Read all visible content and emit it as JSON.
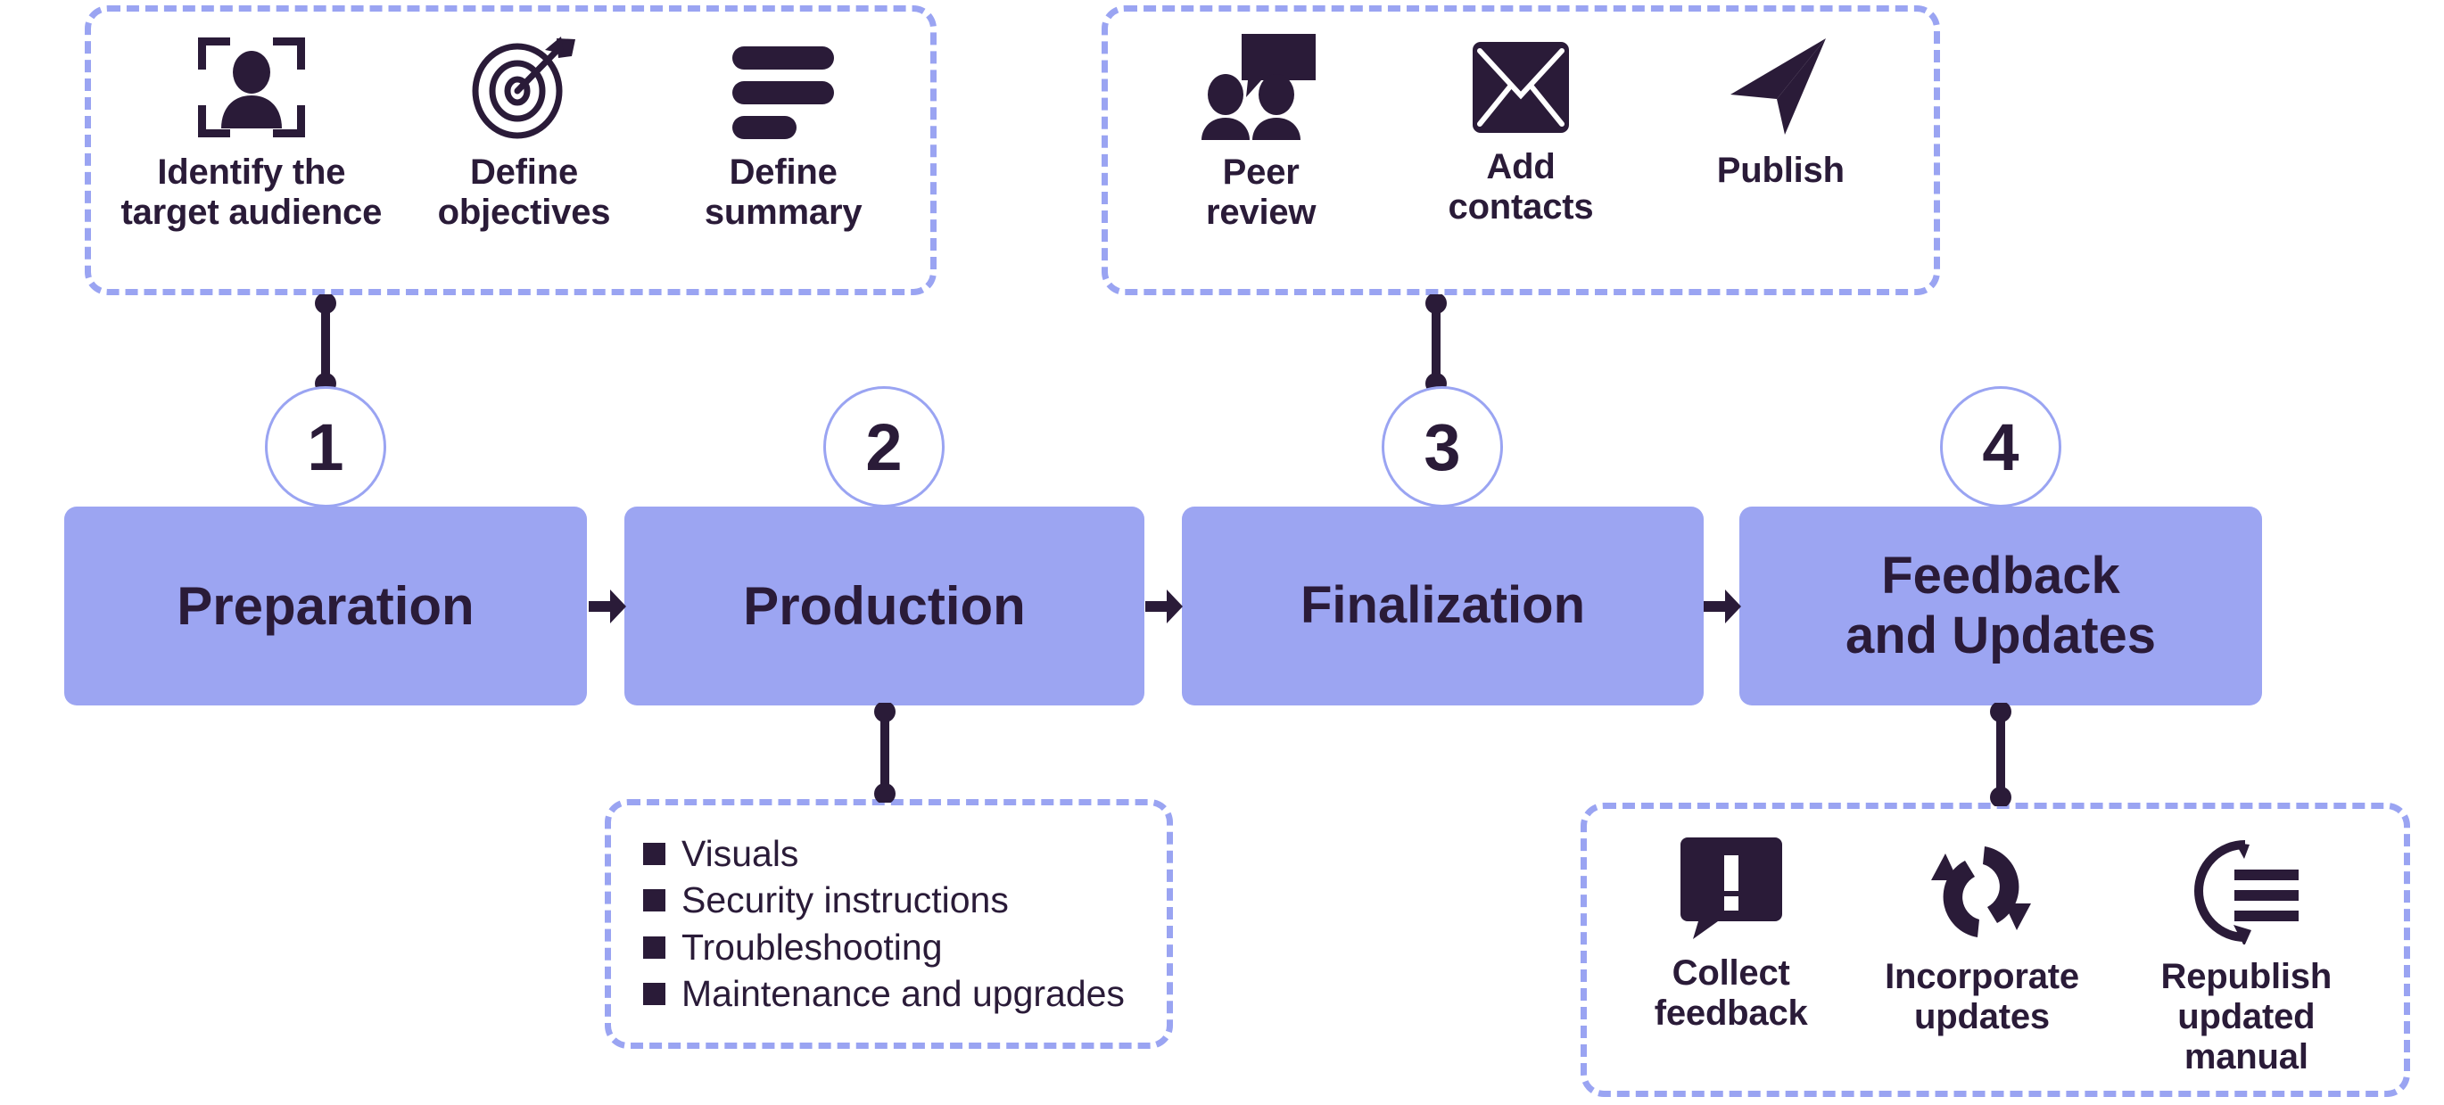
{
  "theme": {
    "box_fill": "#9ca5f2",
    "dash_border": "#9aa4f2",
    "ink": "#2a1b38",
    "background": "#ffffff"
  },
  "stages": [
    {
      "number": "1",
      "title": "Preparation"
    },
    {
      "number": "2",
      "title": "Production"
    },
    {
      "number": "3",
      "title": "Finalization"
    },
    {
      "number": "4",
      "title": "Feedback\nand Updates"
    }
  ],
  "groups": {
    "preparation": {
      "items": [
        {
          "icon": "person-in-frame-icon",
          "label": "Identify the\ntarget audience"
        },
        {
          "icon": "target-arrow-icon",
          "label": "Define\nobjectives"
        },
        {
          "icon": "text-lines-icon",
          "label": "Define\nsummary"
        }
      ]
    },
    "finalization": {
      "items": [
        {
          "icon": "people-speech-bubble-icon",
          "label": "Peer\nreview"
        },
        {
          "icon": "envelope-icon",
          "label": "Add\ncontacts"
        },
        {
          "icon": "paper-plane-icon",
          "label": "Publish"
        }
      ]
    },
    "production": {
      "items": [
        {
          "label": "Visuals"
        },
        {
          "label": "Security instructions"
        },
        {
          "label": "Troubleshooting"
        },
        {
          "label": "Maintenance and upgrades"
        }
      ]
    },
    "feedback": {
      "items": [
        {
          "icon": "alert-speech-bubble-icon",
          "label": "Collect\nfeedback"
        },
        {
          "icon": "refresh-cycle-icon",
          "label": "Incorporate\nupdates"
        },
        {
          "icon": "republish-lines-icon",
          "label": "Republish\nupdated manual"
        }
      ]
    }
  }
}
